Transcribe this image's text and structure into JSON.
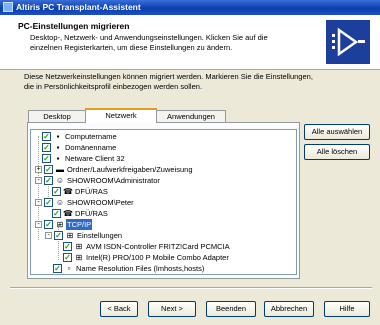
{
  "window": {
    "title": "Altiris PC Transplant-Assistent"
  },
  "header": {
    "title": "PC-Einstellungen migrieren",
    "description": "Desktop-, Netzwerk- und Anwendungseinstellungen.  Klicken Sie auf die einzelnen Registerkarten, um diese Einstellungen zu ändern."
  },
  "intro": "Diese Netzwerkeinstellungen können migriert werden. Markieren Sie die Einstellungen, die in Persönlichkeitsprofil einbezogen werden sollen.",
  "tabs": [
    {
      "label": "Desktop",
      "active": false
    },
    {
      "label": "Netzwerk",
      "active": true
    },
    {
      "label": "Anwendungen",
      "active": false
    }
  ],
  "tree": [
    {
      "label": "Computername",
      "checked": true
    },
    {
      "label": "Domänenname",
      "checked": true
    },
    {
      "label": "Netware Client 32",
      "checked": true
    },
    {
      "label": "Ordner/Laufwerkfreigaben/Zuweisung",
      "checked": true,
      "expander": "+"
    },
    {
      "label": "SHOWROOM\\Administrator",
      "checked": true,
      "expander": "-"
    },
    {
      "label": "DFÜ/RAS",
      "checked": true
    },
    {
      "label": "SHOWROOM\\Peter",
      "checked": true,
      "expander": "-"
    },
    {
      "label": "DFÜ/RAS",
      "checked": true
    },
    {
      "label": "TCP/IP",
      "checked": true,
      "expander": "-",
      "selected": true
    },
    {
      "label": "Einstellungen",
      "checked": true,
      "expander": "-"
    },
    {
      "label": "AVM ISDN-Controller FRITZ!Card PCMCIA",
      "checked": true
    },
    {
      "label": "Intel(R) PRO/100 P Mobile Combo Adapter",
      "checked": true
    },
    {
      "label": "Name Resolution Files (lmhosts,hosts)",
      "checked": true
    }
  ],
  "side_buttons": {
    "select_all": "Alle auswählen",
    "clear_all": "Alle löschen"
  },
  "footer": {
    "back": "< Back",
    "next": "Next >",
    "finish": "Beenden",
    "cancel": "Abbrechen",
    "help": "Hilfe"
  },
  "colors": {
    "title_bar": "#0a3fb0",
    "selection": "#316ac5",
    "logo_bg": "#1c3f9c",
    "active_tab_accent": "#e69b1e"
  }
}
